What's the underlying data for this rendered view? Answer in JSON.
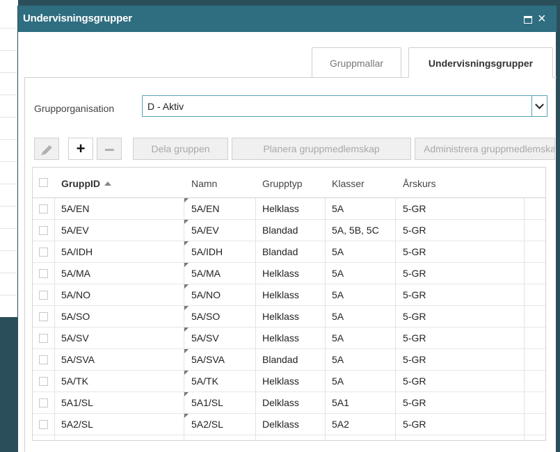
{
  "dialog": {
    "title": "Undervisningsgrupper",
    "close_glyph": "×"
  },
  "tabs": [
    {
      "label": "Gruppmallar",
      "active": false
    },
    {
      "label": "Undervisningsgrupper",
      "active": true
    }
  ],
  "organisation": {
    "label": "Grupporganisation",
    "value": "D - Aktiv"
  },
  "toolbar": {
    "add_glyph": "+",
    "split_label": "Dela gruppen",
    "plan_label": "Planera gruppmedlemskap",
    "admin_label": "Administrera gruppmedlemskap"
  },
  "grid": {
    "columns": [
      "GruppID",
      "Namn",
      "Grupptyp",
      "Klasser",
      "Årskurs"
    ],
    "sorted_column": "GruppID",
    "rows": [
      [
        "5A/EN",
        "5A/EN",
        "Helklass",
        "5A",
        "5-GR"
      ],
      [
        "5A/EV",
        "5A/EV",
        "Blandad",
        "5A, 5B, 5C",
        "5-GR"
      ],
      [
        "5A/IDH",
        "5A/IDH",
        "Blandad",
        "5A",
        "5-GR"
      ],
      [
        "5A/MA",
        "5A/MA",
        "Helklass",
        "5A",
        "5-GR"
      ],
      [
        "5A/NO",
        "5A/NO",
        "Helklass",
        "5A",
        "5-GR"
      ],
      [
        "5A/SO",
        "5A/SO",
        "Helklass",
        "5A",
        "5-GR"
      ],
      [
        "5A/SV",
        "5A/SV",
        "Helklass",
        "5A",
        "5-GR"
      ],
      [
        "5A/SVA",
        "5A/SVA",
        "Blandad",
        "5A",
        "5-GR"
      ],
      [
        "5A/TK",
        "5A/TK",
        "Helklass",
        "5A",
        "5-GR"
      ],
      [
        "5A1/SL",
        "5A1/SL",
        "Delklass",
        "5A1",
        "5-GR"
      ],
      [
        "5A2/SL",
        "5A2/SL",
        "Delklass",
        "5A2",
        "5-GR"
      ]
    ]
  },
  "colors": {
    "titlebar": "#2f6d80",
    "background_app": "#2b4f5a",
    "select_border": "#5aa0b4"
  }
}
